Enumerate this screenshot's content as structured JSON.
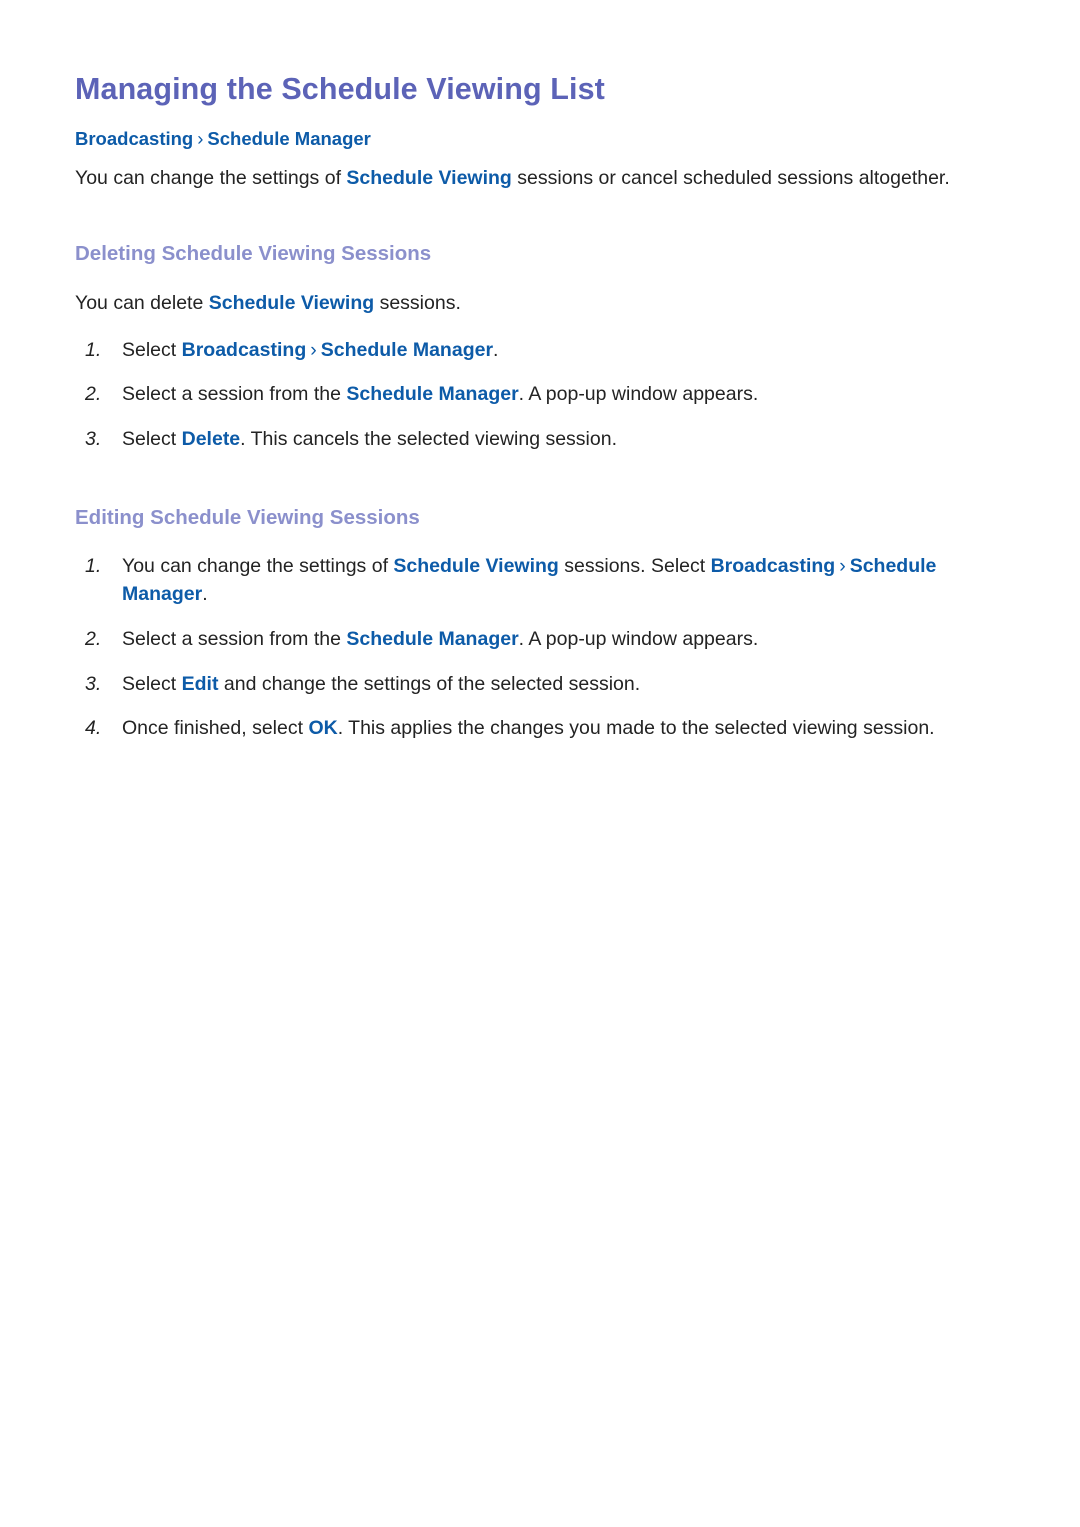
{
  "page": {
    "title": "Managing the Schedule Viewing List",
    "breadcrumb": {
      "first": "Broadcasting",
      "separator": "›",
      "second": "Schedule Manager"
    },
    "intro": {
      "before": "You can change the settings of ",
      "link": "Schedule Viewing",
      "after": " sessions or cancel scheduled sessions altogether."
    }
  },
  "colors": {
    "title": "#5c63b7",
    "section_heading": "#8b90cc",
    "link": "#0d5ba8",
    "body_text": "#232323",
    "background": "#ffffff"
  },
  "sections": [
    {
      "heading": "Deleting Schedule Viewing Sessions",
      "intro": {
        "before": "You can delete ",
        "link": "Schedule Viewing",
        "after": " sessions."
      },
      "steps": [
        {
          "marker": "1.",
          "parts": [
            {
              "type": "text",
              "value": "Select "
            },
            {
              "type": "link",
              "value": "Broadcasting"
            },
            {
              "type": "sep",
              "value": "›"
            },
            {
              "type": "link",
              "value": "Schedule Manager"
            },
            {
              "type": "text",
              "value": "."
            }
          ]
        },
        {
          "marker": "2.",
          "parts": [
            {
              "type": "text",
              "value": "Select a session from the "
            },
            {
              "type": "link",
              "value": "Schedule Manager"
            },
            {
              "type": "text",
              "value": ". A pop-up window appears."
            }
          ]
        },
        {
          "marker": "3.",
          "parts": [
            {
              "type": "text",
              "value": "Select "
            },
            {
              "type": "link",
              "value": "Delete"
            },
            {
              "type": "text",
              "value": ". This cancels the selected viewing session."
            }
          ]
        }
      ]
    },
    {
      "heading": "Editing Schedule Viewing Sessions",
      "intro": null,
      "steps": [
        {
          "marker": "1.",
          "parts": [
            {
              "type": "text",
              "value": "You can change the settings of "
            },
            {
              "type": "link",
              "value": "Schedule Viewing"
            },
            {
              "type": "text",
              "value": " sessions. Select "
            },
            {
              "type": "link",
              "value": "Broadcasting"
            },
            {
              "type": "sep",
              "value": "›"
            },
            {
              "type": "link",
              "value": "Schedule Manager"
            },
            {
              "type": "text",
              "value": "."
            }
          ]
        },
        {
          "marker": "2.",
          "parts": [
            {
              "type": "text",
              "value": "Select a session from the "
            },
            {
              "type": "link",
              "value": "Schedule Manager"
            },
            {
              "type": "text",
              "value": ". A pop-up window appears."
            }
          ]
        },
        {
          "marker": "3.",
          "parts": [
            {
              "type": "text",
              "value": "Select "
            },
            {
              "type": "link",
              "value": "Edit"
            },
            {
              "type": "text",
              "value": " and change the settings of the selected session."
            }
          ]
        },
        {
          "marker": "4.",
          "parts": [
            {
              "type": "text",
              "value": "Once finished, select "
            },
            {
              "type": "link",
              "value": "OK"
            },
            {
              "type": "text",
              "value": ". This applies the changes you made to the selected viewing session."
            }
          ]
        }
      ]
    }
  ]
}
